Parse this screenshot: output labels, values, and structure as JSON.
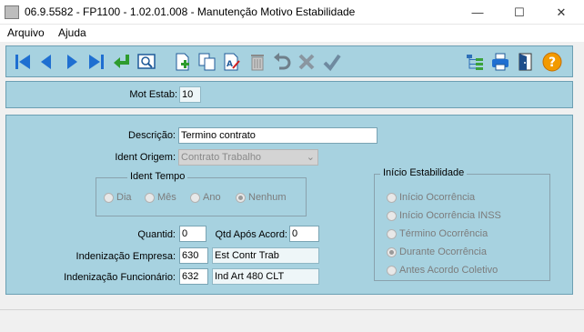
{
  "window": {
    "title": "06.9.5582 - FP1100 - 1.02.01.008 - Manutenção Motivo Estabilidade",
    "minimize": "—",
    "maximize": "☐",
    "close": "✕"
  },
  "menu": {
    "items": [
      {
        "label": "Arquivo"
      },
      {
        "label": "Ajuda"
      }
    ]
  },
  "toolbar": {
    "icons": [
      "first-record-icon",
      "previous-record-icon",
      "next-record-icon",
      "last-record-icon",
      "enter-icon",
      "search-icon",
      "new-record-icon",
      "copy-icon",
      "edit-icon",
      "delete-icon",
      "undo-icon",
      "cancel-icon",
      "confirm-icon",
      "tree-icon",
      "print-icon",
      "exit-icon",
      "help-icon"
    ]
  },
  "colors": {
    "panel": "#a7d2e0",
    "accent_blue": "#1f6fd1",
    "help_orange": "#f29a00"
  },
  "header": {
    "mot_estab_label": "Mot Estab:",
    "mot_estab_value": "10"
  },
  "form": {
    "descricao_label": "Descrição:",
    "descricao_value": "Termino contrato",
    "ident_origem_label": "Ident Origem:",
    "ident_origem_value": "Contrato Trabalho",
    "ident_tempo": {
      "title": "Ident Tempo",
      "options": [
        {
          "label": "Dia",
          "selected": false
        },
        {
          "label": "Mês",
          "selected": false
        },
        {
          "label": "Ano",
          "selected": false
        },
        {
          "label": "Nenhum",
          "selected": true
        }
      ]
    },
    "quantid_label": "Quantid:",
    "quantid_value": "0",
    "qtd_apos_acord_label": "Qtd Após Acord:",
    "qtd_apos_acord_value": "0",
    "indenizacao_empresa_label": "Indenização Empresa:",
    "indenizacao_empresa_code": "630",
    "indenizacao_empresa_desc": "Est Contr Trab",
    "indenizacao_funcionario_label": "Indenização Funcionário:",
    "indenizacao_funcionario_code": "632",
    "indenizacao_funcionario_desc": "Ind Art 480 CLT",
    "inicio_estabilidade": {
      "title": "Início Estabilidade",
      "options": [
        {
          "label": "Início Ocorrência",
          "selected": false
        },
        {
          "label": "Início Ocorrência INSS",
          "selected": false
        },
        {
          "label": "Término Ocorrência",
          "selected": false
        },
        {
          "label": "Durante Ocorrência",
          "selected": true
        },
        {
          "label": "Antes Acordo Coletivo",
          "selected": false
        }
      ]
    }
  }
}
